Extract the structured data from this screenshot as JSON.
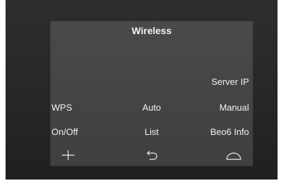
{
  "screen": {
    "title": "Wireless",
    "rows": [
      {
        "left": "",
        "center": "",
        "right": "Server IP"
      },
      {
        "left": "WPS",
        "center": "Auto",
        "right": "Manual"
      },
      {
        "left": "On/Off",
        "center": "List",
        "right": "Beo6 Info"
      }
    ]
  },
  "icons": [
    "plus-icon",
    "back-arrow-icon",
    "home-dome-icon"
  ],
  "colors": {
    "bezel": "#2a2a2a",
    "screen": "#464646",
    "text": "#f2f2f2"
  }
}
